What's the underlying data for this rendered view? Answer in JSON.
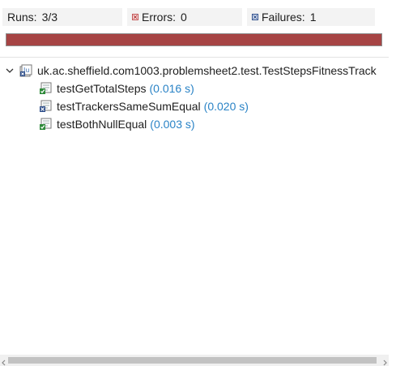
{
  "counters": {
    "runs_label": "Runs:",
    "runs_value": "3/3",
    "errors_label": "Errors:",
    "errors_value": "0",
    "failures_label": "Failures:",
    "failures_value": "1"
  },
  "progress": {
    "fraction": 1.0,
    "color": "#a64444"
  },
  "tree": {
    "suite": {
      "label": "uk.ac.sheffield.com1003.problemsheet2.test.TestStepsFitnessTrack",
      "icon": "junit-suite-failure-icon"
    },
    "tests": [
      {
        "name": "testGetTotalSteps",
        "time": "(0.016 s)",
        "icon": "test-passed-icon"
      },
      {
        "name": "testTrackersSameSumEqual",
        "time": "(0.020 s)",
        "icon": "test-failed-icon"
      },
      {
        "name": "testBothNullEqual",
        "time": "(0.003 s)",
        "icon": "test-passed-icon"
      }
    ]
  },
  "colors": {
    "time_text": "#2a83c6",
    "failure_bar": "#a64444"
  }
}
